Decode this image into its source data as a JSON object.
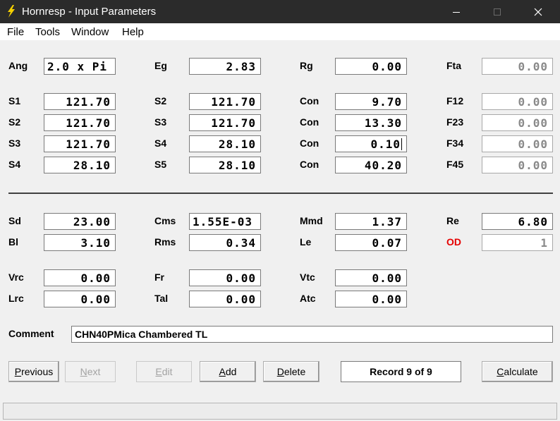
{
  "window": {
    "title": "Hornresp - Input Parameters"
  },
  "menu": [
    "File",
    "Tools",
    "Window",
    "Help"
  ],
  "row_top": {
    "ang": {
      "label": "Ang",
      "value": "2.0 x Pi"
    },
    "eg": {
      "label": "Eg",
      "value": "2.83"
    },
    "rg": {
      "label": "Rg",
      "value": "0.00"
    },
    "fta": {
      "label": "Fta",
      "value": "0.00"
    }
  },
  "horn": [
    {
      "a_label": "S1",
      "a_value": "121.70",
      "b_label": "S2",
      "b_value": "121.70",
      "c_label": "Con",
      "c_value": "9.70",
      "d_label": "F12",
      "d_value": "0.00"
    },
    {
      "a_label": "S2",
      "a_value": "121.70",
      "b_label": "S3",
      "b_value": "121.70",
      "c_label": "Con",
      "c_value": "13.30",
      "d_label": "F23",
      "d_value": "0.00"
    },
    {
      "a_label": "S3",
      "a_value": "121.70",
      "b_label": "S4",
      "b_value": "28.10",
      "c_label": "Con",
      "c_value": "0.10",
      "d_label": "F34",
      "d_value": "0.00"
    },
    {
      "a_label": "S4",
      "a_value": "28.10",
      "b_label": "S5",
      "b_value": "28.10",
      "c_label": "Con",
      "c_value": "40.20",
      "d_label": "F45",
      "d_value": "0.00"
    }
  ],
  "driver": {
    "sd": {
      "label": "Sd",
      "value": "23.00"
    },
    "cms": {
      "label": "Cms",
      "value": "1.55E-03"
    },
    "mmd": {
      "label": "Mmd",
      "value": "1.37"
    },
    "re": {
      "label": "Re",
      "value": "6.80"
    },
    "bl": {
      "label": "Bl",
      "value": "3.10"
    },
    "rms": {
      "label": "Rms",
      "value": "0.34"
    },
    "le": {
      "label": "Le",
      "value": "0.07"
    },
    "od": {
      "label": "OD",
      "value": "1"
    }
  },
  "chambers": {
    "vrc": {
      "label": "Vrc",
      "value": "0.00"
    },
    "fr": {
      "label": "Fr",
      "value": "0.00"
    },
    "vtc": {
      "label": "Vtc",
      "value": "0.00"
    },
    "lrc": {
      "label": "Lrc",
      "value": "0.00"
    },
    "tal": {
      "label": "Tal",
      "value": "0.00"
    },
    "atc": {
      "label": "Atc",
      "value": "0.00"
    }
  },
  "comment": {
    "label": "Comment",
    "value": "CHN40PMica Chambered TL"
  },
  "buttons": {
    "previous": {
      "u": "P",
      "rest": "revious"
    },
    "next": {
      "u": "N",
      "rest": "ext"
    },
    "edit": {
      "u": "E",
      "rest": "dit"
    },
    "add": {
      "u": "A",
      "rest": "dd"
    },
    "delete": {
      "u": "D",
      "rest": "elete"
    },
    "calculate": {
      "u": "C",
      "rest": "alculate"
    }
  },
  "record": "Record 9 of 9",
  "colors": {
    "titlebar": "#2b2b2b",
    "od_label": "#e50000",
    "icon": "#f5d000"
  }
}
